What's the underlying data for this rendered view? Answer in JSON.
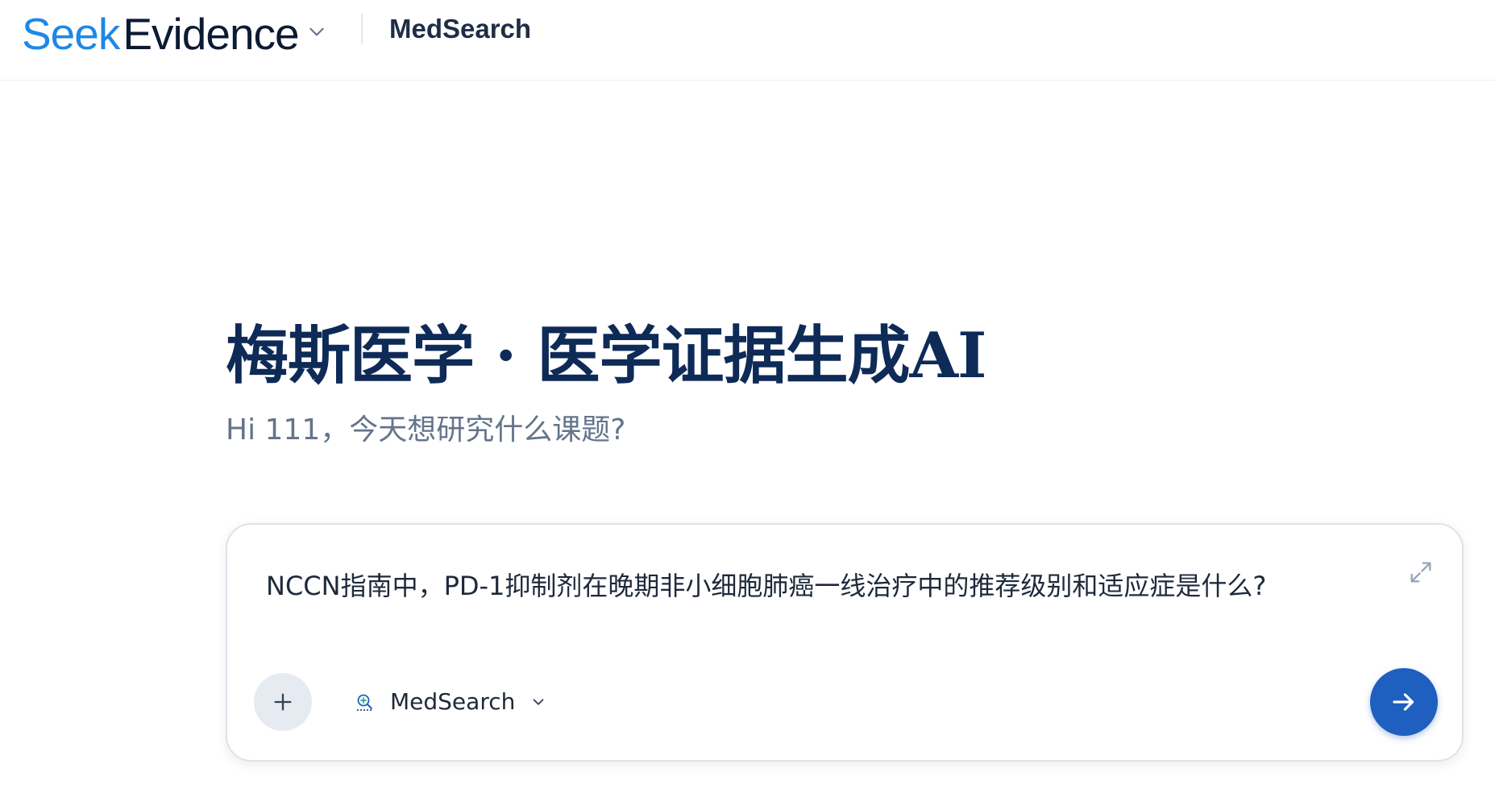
{
  "header": {
    "logo_part1": "Seek",
    "logo_part2": "Evidence",
    "app_name": "MedSearch"
  },
  "hero": {
    "title": "梅斯医学 · 医学证据生成AI",
    "subtitle": "Hi 111，今天想研究什么课题?"
  },
  "composer": {
    "query": "NCCN指南中，PD-1抑制剂在晚期非小细胞肺癌一线治疗中的推荐级别和适应症是什么?",
    "model_label": "MedSearch"
  },
  "icons": {
    "product_switch": "chevron-down-icon",
    "expand": "expand-icon",
    "attach": "plus-icon",
    "model": "medsearch-logo-icon",
    "model_dropdown": "chevron-down-icon",
    "send": "arrow-right-icon"
  },
  "colors": {
    "brand_blue": "#1e88e5",
    "brand_dark": "#0b1b33",
    "title_navy": "#0e2a57",
    "send_button": "#1e5fbf",
    "subtitle_gray": "#64748b"
  }
}
